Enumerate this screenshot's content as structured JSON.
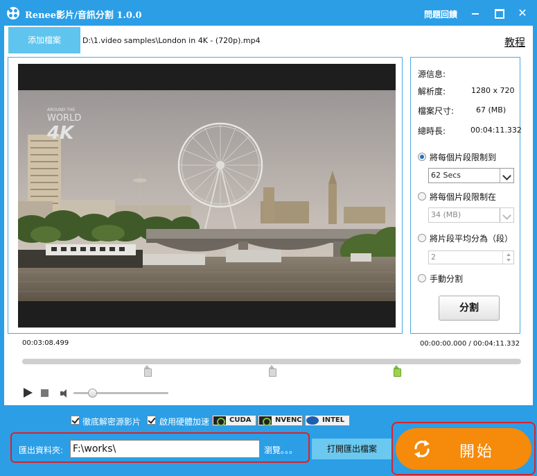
{
  "titlebar": {
    "title": "Renee影片/音訊分割 1.0.0",
    "feedback": "問題回饋"
  },
  "toolbar": {
    "add_file": "添加檔案",
    "file_path": "D:\\1.video samples\\London in 4K - (720p).mp4",
    "tutorial": "教程"
  },
  "video": {
    "overlay_line1": "AROUND THE",
    "overlay_line2": "WORLD",
    "overlay_line3": "4K"
  },
  "info": {
    "source_label": "源信息:",
    "resolution_label": "解析度:",
    "resolution_value": "1280 x 720",
    "size_label": "檔案尺寸:",
    "size_value": "67 (MB)",
    "duration_label": "總時長:",
    "duration_value": "00:04:11.332"
  },
  "split_options": {
    "opt1_label": "將每個片段限制到",
    "opt1_value": "62 Secs",
    "opt2_label": "將每個片段限制在",
    "opt2_value": "34 (MB)",
    "opt3_label": "將片段平均分為（段）",
    "opt3_value": "2",
    "opt4_label": "手動分割",
    "selected": 1,
    "split_button": "分割"
  },
  "timeline": {
    "current_time": "00:03:08.499",
    "range": "00:00:00.000 / 00:04:11.332",
    "markers": [
      0.25,
      0.5,
      0.75
    ],
    "active_marker": 2,
    "volume": 0.2
  },
  "options": {
    "decrypt_label": "徹底解密源影片",
    "hw_accel_label": "啟用硬體加速",
    "gpu_cuda": "CUDA",
    "gpu_nvenc": "NVENC",
    "gpu_intel": "INTEL"
  },
  "output": {
    "label": "匯出資料夾:",
    "folder": "F:\\works\\",
    "browse": "瀏覽。。。",
    "open_folder": "打開匯出檔案"
  },
  "start": {
    "label": "開始"
  },
  "colors": {
    "brand_blue": "#2b9ee6",
    "start_orange": "#f58a0b",
    "highlight_red": "#d8232a"
  }
}
